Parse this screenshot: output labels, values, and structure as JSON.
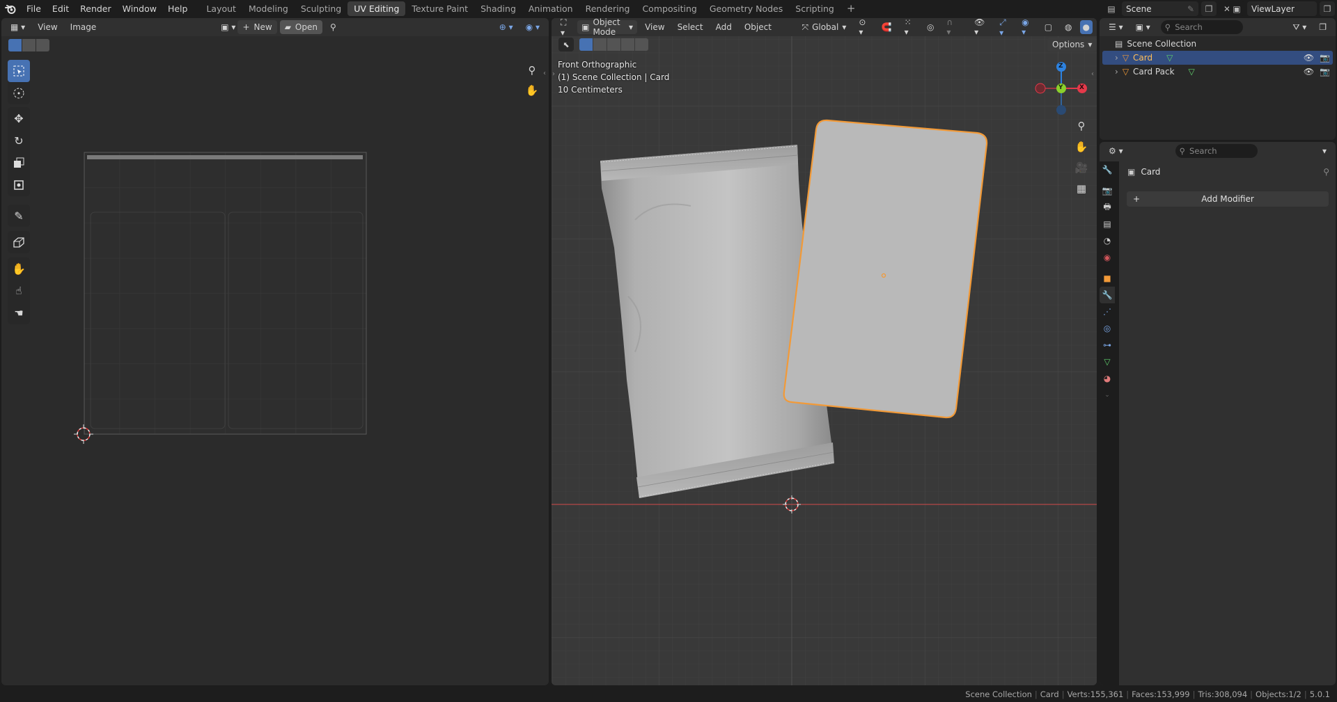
{
  "menu": [
    "File",
    "Edit",
    "Render",
    "Window",
    "Help"
  ],
  "workspaces": [
    "Layout",
    "Modeling",
    "Sculpting",
    "UV Editing",
    "Texture Paint",
    "Shading",
    "Animation",
    "Rendering",
    "Compositing",
    "Geometry Nodes",
    "Scripting"
  ],
  "active_workspace": "UV Editing",
  "scene_label": "Scene",
  "viewlayer_label": "ViewLayer",
  "uv_editor": {
    "menus": [
      "View",
      "Image"
    ],
    "new_label": "New",
    "open_label": "Open"
  },
  "viewport": {
    "mode_label": "Object Mode",
    "menus": [
      "View",
      "Select",
      "Add",
      "Object"
    ],
    "orientation_label": "Global",
    "options_label": "Options",
    "overlay_lines": [
      "Front Orthographic",
      "(1) Scene Collection | Card",
      "10 Centimeters"
    ],
    "gizmo_axes": {
      "z": "Z",
      "y": "Y",
      "x": "X"
    }
  },
  "outliner": {
    "search_placeholder": "Search",
    "collection_label": "Scene Collection",
    "items": [
      {
        "label": "Card",
        "selected": true
      },
      {
        "label": "Card Pack",
        "selected": false
      }
    ]
  },
  "properties": {
    "search_placeholder": "Search",
    "object_name": "Card",
    "add_modifier_label": "Add Modifier"
  },
  "status": {
    "collection": "Scene Collection",
    "object": "Card",
    "verts": "Verts:155,361",
    "faces": "Faces:153,999",
    "tris": "Tris:308,094",
    "objects": "Objects:1/2",
    "version": "5.0.1"
  },
  "colors": {
    "accent": "#4772b3",
    "selection_outline": "#f29a38",
    "x_axis": "#e4394a",
    "y_axis": "#8bd02c",
    "z_axis": "#2d82e0"
  }
}
